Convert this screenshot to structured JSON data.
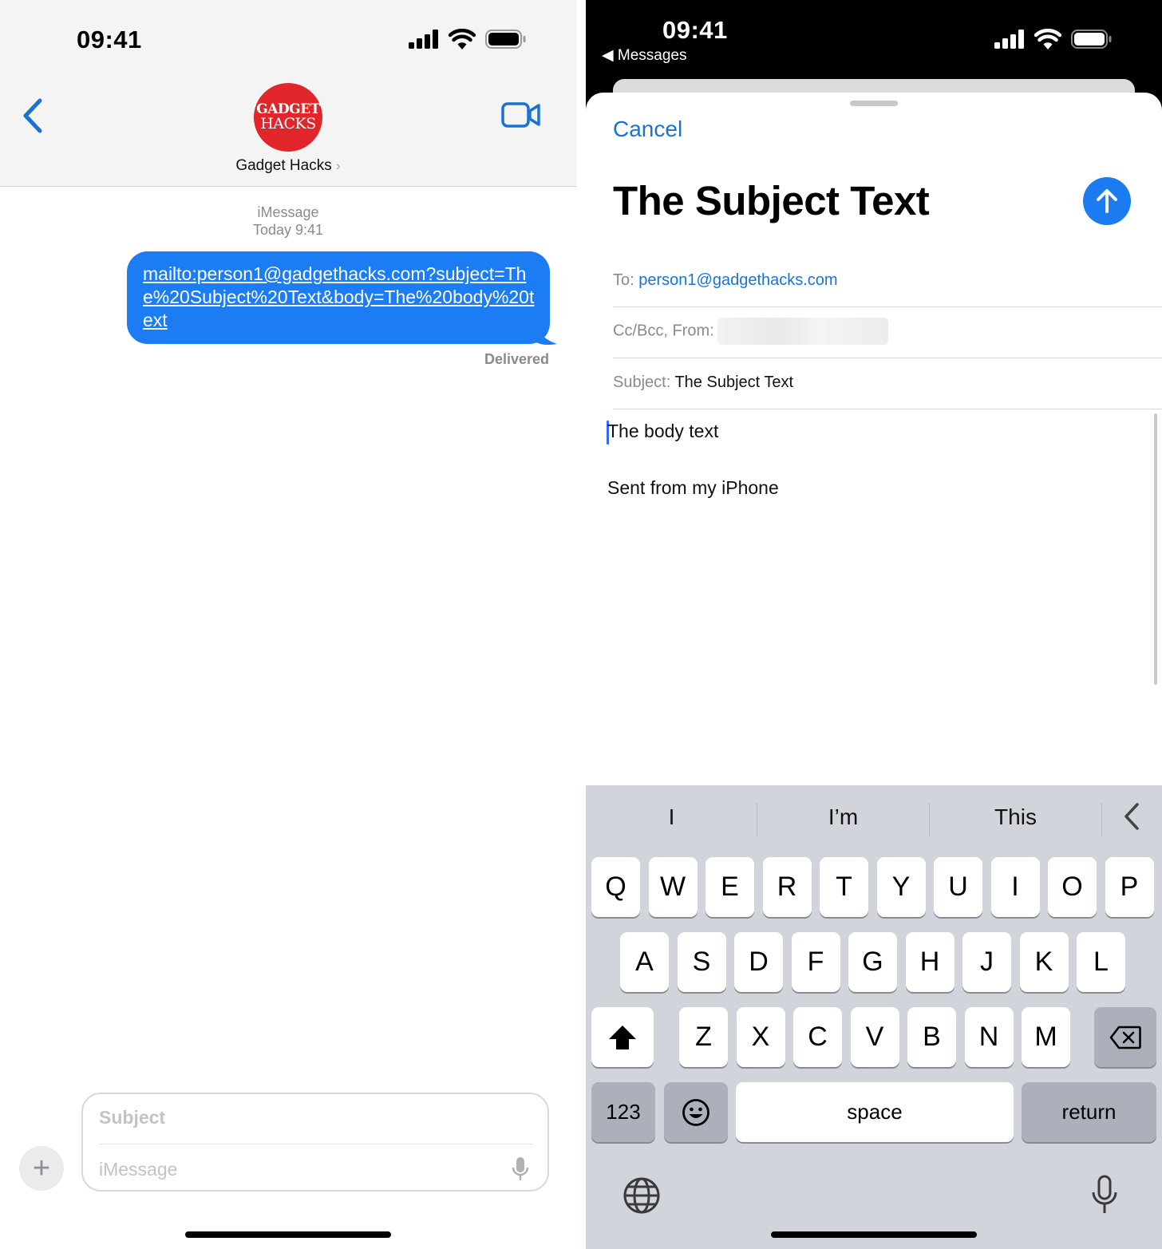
{
  "messages": {
    "status": {
      "time": "09:41"
    },
    "header": {
      "contact_name": "Gadget Hacks",
      "avatar_line1": "GADGET",
      "avatar_line2": "HACKS",
      "chevron": "›"
    },
    "thread": {
      "service": "iMessage",
      "timestamp": "Today 9:41",
      "bubble_text": "mailto:person1@gadgethacks.com?subject=The%20Subject%20Text&body=The%20body%20text",
      "delivery_status": "Delivered",
      "bubble_color": "#1b7cf3"
    },
    "composer": {
      "subject_placeholder": "Subject",
      "message_placeholder": "iMessage",
      "plus": "+"
    }
  },
  "mail": {
    "status": {
      "time": "09:41",
      "back_label": "◀ Messages"
    },
    "cancel_label": "Cancel",
    "title": "The Subject Text",
    "to_label": "To:",
    "to_value": "person1@gadgethacks.com",
    "ccbcc_label": "Cc/Bcc, From:",
    "subject_label": "Subject:",
    "subject_value": "The Subject Text",
    "body_text": "The body text",
    "signature": "Sent from my iPhone",
    "accent_color": "#1a73d4"
  },
  "keyboard": {
    "suggestions": [
      "I",
      "I’m",
      "This"
    ],
    "row1": [
      "Q",
      "W",
      "E",
      "R",
      "T",
      "Y",
      "U",
      "I",
      "O",
      "P"
    ],
    "row2": [
      "A",
      "S",
      "D",
      "F",
      "G",
      "H",
      "J",
      "K",
      "L"
    ],
    "row3": [
      "Z",
      "X",
      "C",
      "V",
      "B",
      "N",
      "M"
    ],
    "numbers_label": "123",
    "space_label": "space",
    "return_label": "return"
  }
}
